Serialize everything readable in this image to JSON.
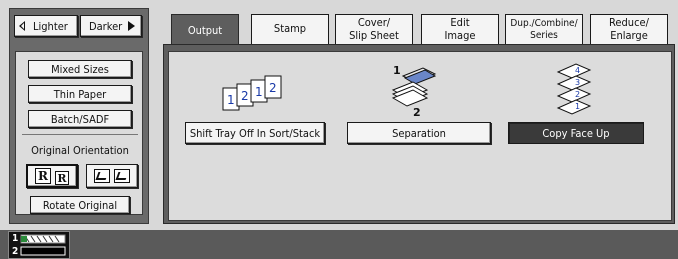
{
  "density": {
    "lighter_label": "Lighter",
    "darker_label": "Darker"
  },
  "side": {
    "mixed_sizes": "Mixed Sizes",
    "thin_paper": "Thin Paper",
    "batch_sadf": "Batch/SADF",
    "orientation_label": "Original Orientation",
    "rotate_original": "Rotate Original"
  },
  "tabs": {
    "output": "Output",
    "stamp": "Stamp",
    "cover": "Cover/\nSlip Sheet",
    "edit": "Edit\nImage",
    "dup": "Dup./Combine/\nSeries",
    "reduce": "Reduce/\nEnlarge"
  },
  "output": {
    "shift_tray": "Shift Tray Off In Sort/Stack",
    "separation": "Separation",
    "copy_face_up": "Copy Face Up",
    "separation_num_1": "1",
    "separation_num_2": "2",
    "shift_pages": [
      "1",
      "2",
      "1",
      "2"
    ],
    "face_up_pages": [
      "4",
      "3",
      "2",
      "1"
    ]
  },
  "tray": {
    "num1": "1",
    "num2": "2"
  }
}
